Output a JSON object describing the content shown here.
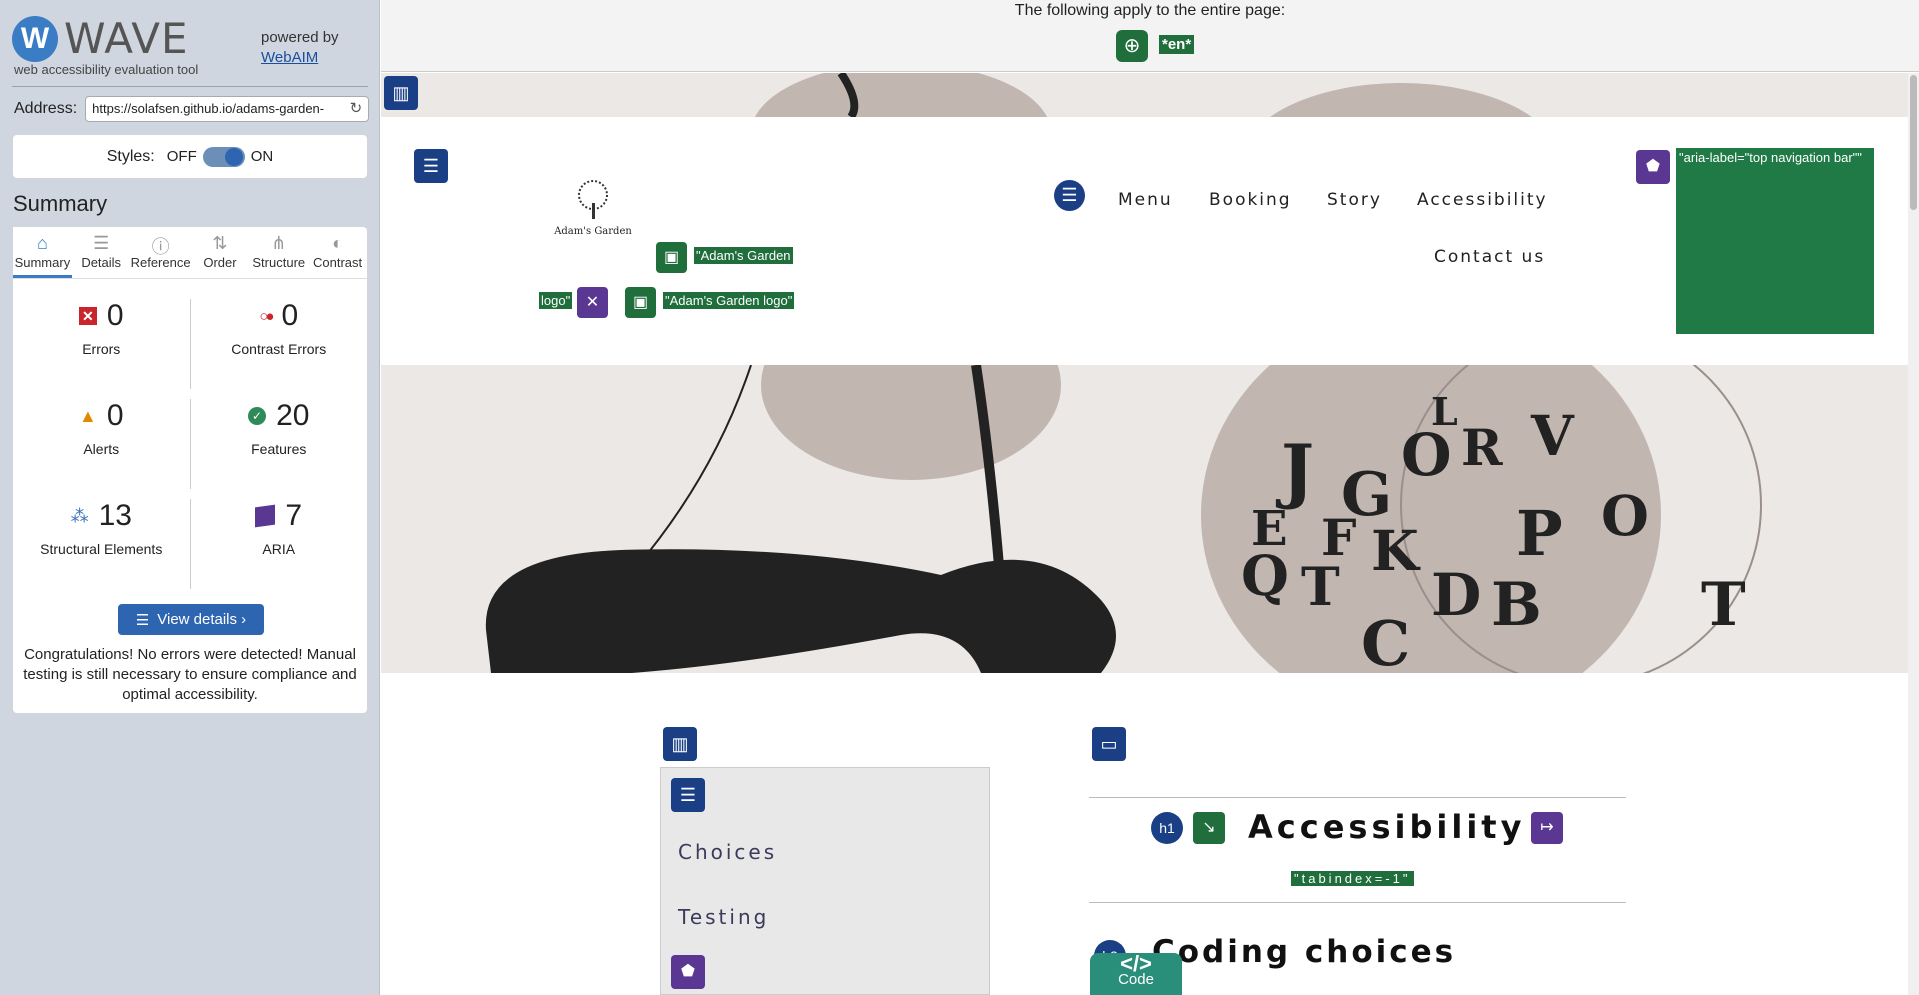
{
  "sidebar": {
    "logo_text": "WAVE",
    "logo_sub": "web accessibility evaluation tool",
    "powered_by": "powered by",
    "webaim": "WebAIM",
    "address_label": "Address:",
    "address_value": "https://solafsen.github.io/adams-garden-",
    "styles_label": "Styles:",
    "styles_off": "OFF",
    "styles_on": "ON",
    "summary_title": "Summary",
    "tabs": [
      {
        "label": "Summary"
      },
      {
        "label": "Details"
      },
      {
        "label": "Reference"
      },
      {
        "label": "Order"
      },
      {
        "label": "Structure"
      },
      {
        "label": "Contrast"
      }
    ],
    "stats": {
      "errors": {
        "value": "0",
        "label": "Errors"
      },
      "contrast_errors": {
        "value": "0",
        "label": "Contrast Errors"
      },
      "alerts": {
        "value": "0",
        "label": "Alerts"
      },
      "features": {
        "value": "20",
        "label": "Features"
      },
      "structural": {
        "value": "13",
        "label": "Structural Elements"
      },
      "aria": {
        "value": "7",
        "label": "ARIA"
      }
    },
    "view_details": "View details ›",
    "congrats": "Congratulations! No errors were detected! Manual testing is still necessary to ensure compliance and optimal accessibility."
  },
  "page": {
    "apply_text": "The following apply to the entire page:",
    "lang_tag": "*en*",
    "logo_caption": "Adam's Garden",
    "tag_alt1": "\"Adam's Garden",
    "tag_alt1b": "logo\"",
    "tag_alt2": "\"Adam's Garden logo\"",
    "nav": [
      "Menu",
      "Booking",
      "Story",
      "Accessibility",
      "Contact us"
    ],
    "aria_label": "\"aria-label=\"top navigation bar\"\"",
    "side_links": [
      "Choices",
      "Testing"
    ],
    "h1": "Accessibility",
    "tabindex_tag": "\"tabindex=-1\"",
    "h2": "Coding choices",
    "code_tab": "Code",
    "code_sym": "</>"
  },
  "colors": {
    "wave_green": "#1f6e3c",
    "wave_blue": "#1a3f85",
    "wave_purple": "#5a3792",
    "sidebar_bg": "#cfd6df",
    "hero_bg": "#ebe8e5"
  }
}
